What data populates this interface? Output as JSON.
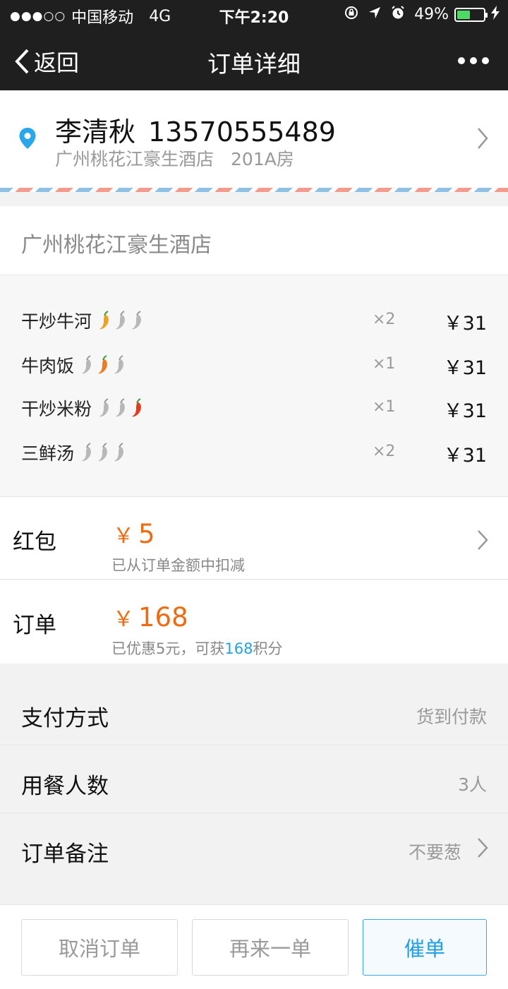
{
  "status_bar": {
    "signal_dots": "●●●○○",
    "carrier": "中国移动",
    "network": "4G",
    "time": "下午2:20",
    "battery": "49%",
    "battery_level": 0.49
  },
  "nav": {
    "back_label": "返回",
    "title": "订单详细"
  },
  "address": {
    "name": "李清秋",
    "phone": "13570555489",
    "location": "广州桃花江豪生酒店",
    "room": "201A房"
  },
  "shop": {
    "name": "广州桃花江豪生酒店"
  },
  "items": [
    {
      "name": "干炒牛河",
      "spice": 1,
      "qty": "×2",
      "price": "￥31"
    },
    {
      "name": "牛肉饭",
      "spice": 2,
      "qty": "×1",
      "price": "￥31"
    },
    {
      "name": "干炒米粉",
      "spice": 3,
      "qty": "×1",
      "price": "￥31"
    },
    {
      "name": "三鲜汤",
      "spice": 0,
      "qty": "×2",
      "price": "￥31"
    }
  ],
  "hongbao": {
    "label": "红包",
    "currency": "￥",
    "amount": "5",
    "note": "已从订单金额中扣减"
  },
  "order_summary": {
    "label": "订单",
    "currency": "￥",
    "amount": "168",
    "note_prefix": "已优惠5元，可获",
    "points": "168",
    "note_suffix": "积分"
  },
  "options": {
    "payment": {
      "label": "支付方式",
      "value": "货到付款"
    },
    "diners": {
      "label": "用餐人数",
      "value": "3人"
    },
    "remark": {
      "label": "订单备注",
      "value": "不要葱"
    }
  },
  "buttons": {
    "cancel": "取消订单",
    "again": "再来一单",
    "urge": "催单"
  },
  "colors": {
    "accent_orange": "#f06a0f",
    "accent_blue": "#1e9fe6",
    "nav_bg": "#1f1f20",
    "pepper_level_1": "#f0a21e",
    "pepper_level_2": "#f07a1e",
    "pepper_level_3": "#e8381e",
    "pepper_off": "#b8b8b8"
  }
}
